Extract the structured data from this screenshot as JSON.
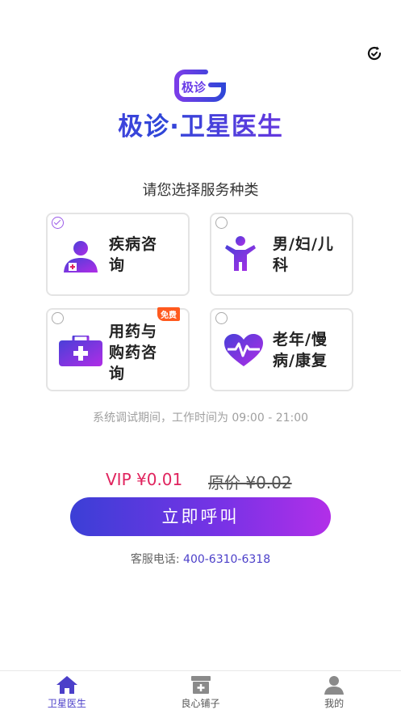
{
  "app": {
    "logo_mark": "极诊",
    "title": "极诊·卫星医生"
  },
  "subtitle": "请您选择服务种类",
  "services": [
    {
      "label_line1": "疾病咨",
      "label_line2": "询",
      "label_line3": "",
      "icon": "doctor-icon",
      "selected": true,
      "badge": ""
    },
    {
      "label_line1": "男/妇/儿",
      "label_line2": "科",
      "label_line3": "",
      "icon": "child-icon",
      "selected": false,
      "badge": ""
    },
    {
      "label_line1": "用药与",
      "label_line2": "购药咨",
      "label_line3": "询",
      "icon": "medical-kit-icon",
      "selected": false,
      "badge": "免费"
    },
    {
      "label_line1": "老年/慢",
      "label_line2": "病/康复",
      "label_line3": "",
      "icon": "heart-pulse-icon",
      "selected": false,
      "badge": ""
    }
  ],
  "notice": "系统调试期间，工作时间为 09:00 - 21:00",
  "price": {
    "vip": "VIP ¥0.01",
    "original": "原价 ¥0.02"
  },
  "call_button": "立即呼叫",
  "customer_service": {
    "label": "客服电话:",
    "phone": "400-6310-6318"
  },
  "tabs": [
    {
      "label": "卫星医生",
      "icon": "home-icon",
      "active": true
    },
    {
      "label": "良心铺子",
      "icon": "shop-icon",
      "active": false
    },
    {
      "label": "我的",
      "icon": "user-icon",
      "active": false
    }
  ],
  "colors": {
    "accent": "#4b3fc9",
    "vip_price": "#e0245e",
    "badge": "#ff5a1f",
    "button_start": "#3b3fd6",
    "button_end": "#b22fe8"
  }
}
